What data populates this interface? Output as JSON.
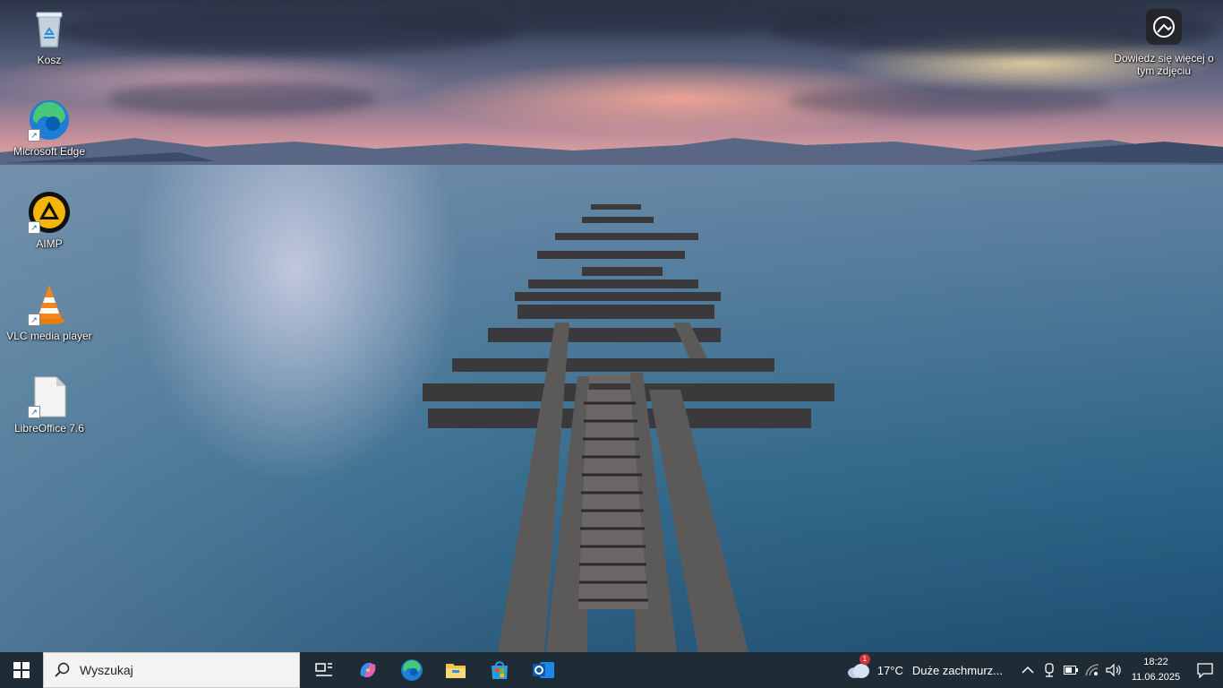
{
  "desktop": {
    "icons": [
      {
        "label": "Kosz",
        "icon": "recycle-bin-icon"
      },
      {
        "label": "Microsoft Edge",
        "icon": "edge-icon"
      },
      {
        "label": "AIMP",
        "icon": "aimp-icon"
      },
      {
        "label": "VLC media player",
        "icon": "vlc-icon"
      },
      {
        "label": "LibreOffice 7.6",
        "icon": "libreoffice-icon"
      }
    ],
    "learn_more": "Dowiedz się więcej o tym zdjęciu"
  },
  "taskbar": {
    "search_placeholder": "Wyszukaj",
    "apps": [
      "task-view-icon",
      "copilot-icon",
      "edge-icon",
      "file-explorer-icon",
      "store-icon",
      "outlook-icon"
    ],
    "weather": {
      "badge": "1",
      "temperature": "17°C",
      "description": "Duże zachmurz..."
    },
    "clock": {
      "time": "18:22",
      "date": "11.06.2025"
    }
  },
  "colors": {
    "taskbar_bg": "#1f2b35",
    "accent": "#0078d4"
  }
}
